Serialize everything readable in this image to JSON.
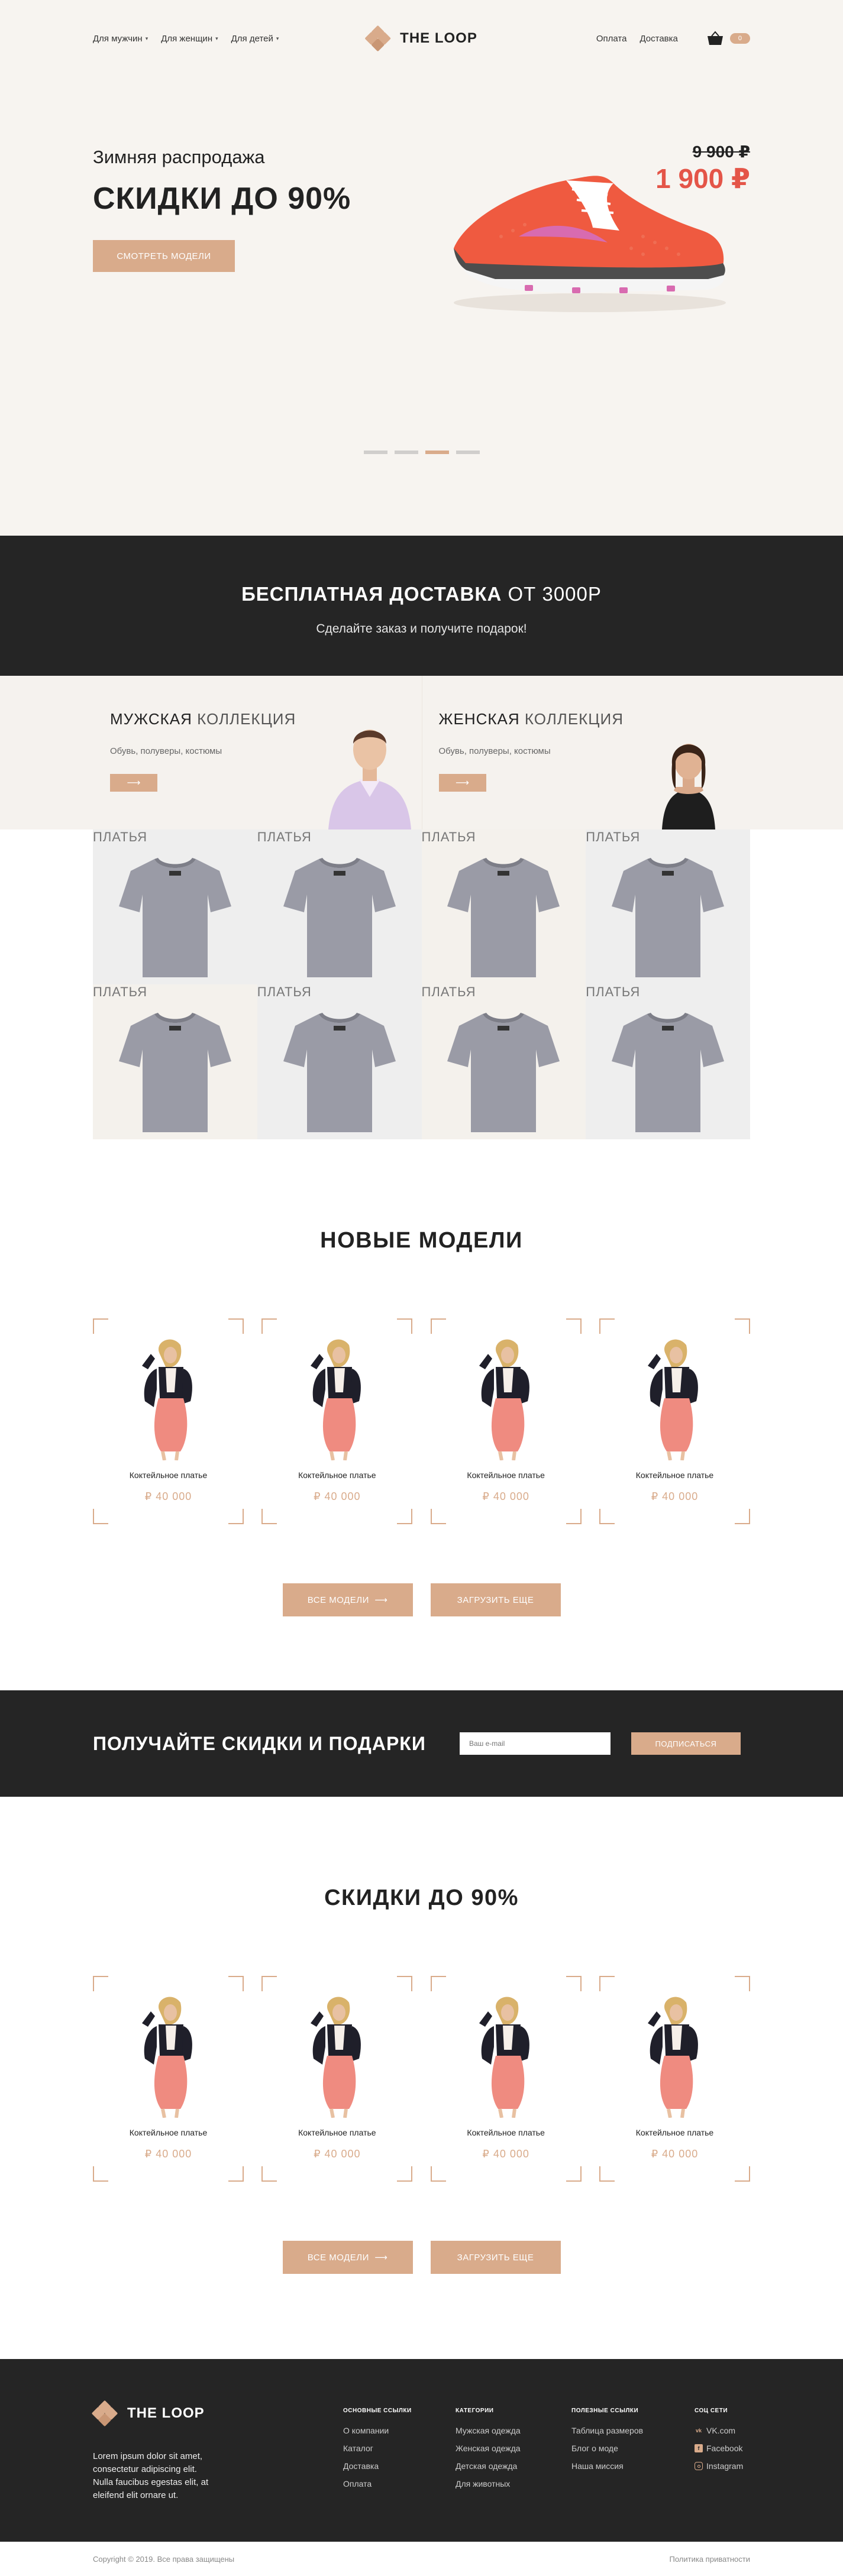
{
  "nav": {
    "left": [
      {
        "label": "Для мужчин"
      },
      {
        "label": "Для женщин"
      },
      {
        "label": "Для детей"
      }
    ],
    "logo": "THE LOOP",
    "right": [
      {
        "label": "Оплата"
      },
      {
        "label": "Доставка"
      }
    ],
    "cart_count": "0"
  },
  "hero": {
    "subtitle": "Зимняя распродажа",
    "title": "СКИДКИ ДО 90%",
    "button": "СМОТРЕТЬ МОДЕЛИ",
    "old_price": "9 900 ₽",
    "new_price": "1 900 ₽",
    "slides": 4,
    "active_slide": 3
  },
  "delivery": {
    "title_bold": "БЕСПЛАТНАЯ ДОСТАВКА",
    "title_rest": "ОТ 3000Р",
    "subtitle": "Сделайте заказ и получите подарок!"
  },
  "collections": {
    "men": {
      "title_bold": "МУЖСКАЯ",
      "title_rest": "КОЛЛЕКЦИЯ",
      "desc": "Обувь, полуверы, костюмы",
      "arrow": "⟶"
    },
    "women": {
      "title_bold": "ЖЕНСКАЯ",
      "title_rest": "КОЛЛЕКЦИЯ",
      "desc": "Обувь, полуверы, костюмы",
      "arrow": "⟶"
    }
  },
  "grid": [
    {
      "label": "ПЛАТЬЯ"
    },
    {
      "label": "ПЛАТЬЯ"
    },
    {
      "label": "ПЛАТЬЯ"
    },
    {
      "label": "ПЛАТЬЯ"
    },
    {
      "label": "ПЛАТЬЯ"
    },
    {
      "label": "ПЛАТЬЯ"
    },
    {
      "label": "ПЛАТЬЯ"
    },
    {
      "label": "ПЛАТЬЯ"
    }
  ],
  "new_models": {
    "title": "НОВЫЕ МОДЕЛИ",
    "cards": [
      {
        "name": "Коктейльное платье",
        "price": "₽ 40 000"
      },
      {
        "name": "Коктейльное платье",
        "price": "₽ 40 000"
      },
      {
        "name": "Коктейльное платье",
        "price": "₽ 40 000"
      },
      {
        "name": "Коктейльное платье",
        "price": "₽ 40 000"
      }
    ],
    "btn_all": "ВСЕ МОДЕЛИ",
    "btn_more": "ЗАГРУЗИТЬ ЕЩЕ"
  },
  "subscribe": {
    "title": "ПОЛУЧАЙТЕ СКИДКИ И ПОДАРКИ",
    "placeholder": "Ваш e-mail",
    "button": "ПОДПИСАТЬСЯ"
  },
  "sale": {
    "title": "СКИДКИ ДО 90%",
    "cards": [
      {
        "name": "Коктейльное платье",
        "price": "₽ 40 000"
      },
      {
        "name": "Коктейльное платье",
        "price": "₽ 40 000"
      },
      {
        "name": "Коктейльное платье",
        "price": "₽ 40 000"
      },
      {
        "name": "Коктейльное платье",
        "price": "₽ 40 000"
      }
    ],
    "btn_all": "ВСЕ МОДЕЛИ",
    "btn_more": "ЗАГРУЗИТЬ ЕЩЕ"
  },
  "footer": {
    "logo": "THE LOOP",
    "about": "Lorem ipsum dolor sit amet, consectetur adipiscing elit. Nulla faucibus egestas elit, at eleifend elit ornare ut.",
    "cols": [
      {
        "title": "ОСНОВНЫЕ ССЫЛКИ",
        "links": [
          "О компании",
          "Каталог",
          "Доставка",
          "Оплата"
        ]
      },
      {
        "title": "КАТЕГОРИИ",
        "links": [
          "Мужская одежда",
          "Женская одежда",
          "Детская одежда",
          "Для животных"
        ]
      },
      {
        "title": "ПОЛЕЗНЫЕ ССЫЛКИ",
        "links": [
          "Таблица размеров",
          "Блог о моде",
          "Наша миссия"
        ]
      },
      {
        "title": "СОЦ СЕТИ",
        "links": [
          "VK.com",
          "Facebook",
          "Instagram"
        ]
      }
    ],
    "copyright": "Copyright © 2019. Все права защищены",
    "privacy": "Политика приватности"
  },
  "colors": {
    "accent": "#d9ab8b",
    "dark": "#252525",
    "price_red": "#e45548",
    "hero_bg": "#f7f4f0"
  },
  "icons": [
    "logo-icon",
    "cart-icon",
    "arrow-right-icon",
    "vk-icon",
    "facebook-icon",
    "instagram-icon"
  ]
}
